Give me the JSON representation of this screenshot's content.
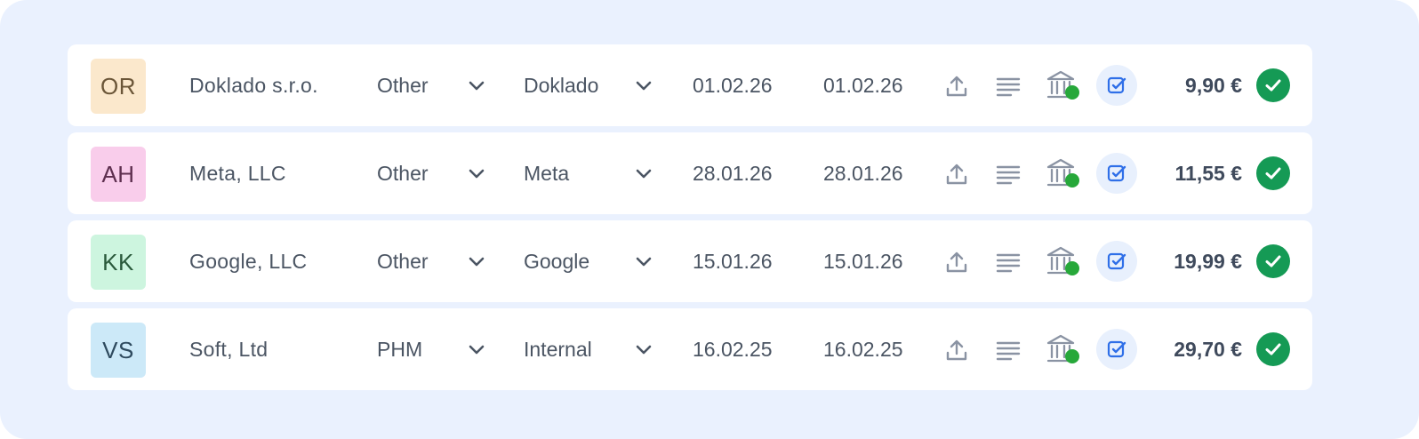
{
  "colors": {
    "panel_bg": "#EAF1FE",
    "text": "#4B5563",
    "amount_text": "#3F4A5C",
    "icon": "#8A93A3",
    "accent_blue": "#2F6FE8",
    "status_green": "#159A55",
    "bank_dot_green": "#27A83A"
  },
  "icons": {
    "dropdown": "chevron-down-icon",
    "upload": "upload-icon",
    "notes": "notes-lines-icon",
    "bank": "bank-icon",
    "task": "checkbox-task-icon",
    "status": "check-circle-icon"
  },
  "rows": [
    {
      "initials": "OR",
      "avatar_bg": "#FBE8CC",
      "avatar_fg": "#6B5638",
      "company": "Doklado s.r.o.",
      "category": "Other",
      "vendor": "Doklado",
      "date1": "01.02.26",
      "date2": "01.02.26",
      "amount": "9,90 €"
    },
    {
      "initials": "AH",
      "avatar_bg": "#F9CDEB",
      "avatar_fg": "#5E2F4F",
      "company": "Meta, LLC",
      "category": "Other",
      "vendor": "Meta",
      "date1": "28.01.26",
      "date2": "28.01.26",
      "amount": "11,55 €"
    },
    {
      "initials": "KK",
      "avatar_bg": "#CDF5DF",
      "avatar_fg": "#2B5A3C",
      "company": "Google, LLC",
      "category": "Other",
      "vendor": "Google",
      "date1": "15.01.26",
      "date2": "15.01.26",
      "amount": "19,99 €"
    },
    {
      "initials": "VS",
      "avatar_bg": "#CCE9F8",
      "avatar_fg": "#2E4A5E",
      "company": "Soft, Ltd",
      "category": "PHM",
      "vendor": "Internal",
      "date1": "16.02.25",
      "date2": "16.02.25",
      "amount": "29,70 €"
    }
  ]
}
